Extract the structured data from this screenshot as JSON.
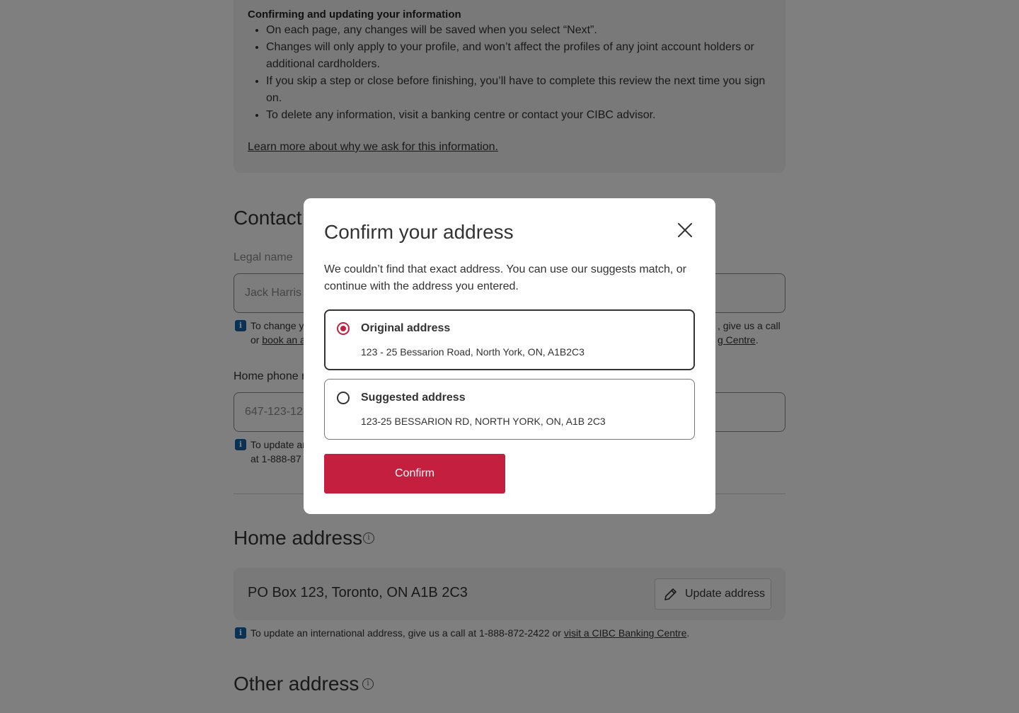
{
  "info_panel": {
    "heading": "Confirming and updating your information",
    "bullets": [
      "On each page, any changes will be saved when you select “Next”.",
      "Changes will only apply to your profile, and won’t affect the profiles of any joint account holders or additional cardholders.",
      "If you skip a step or close before finishing, you’ll have to complete this review the next time you sign on.",
      "To delete any information, visit a banking centre or contact your CIBC advisor."
    ],
    "learn_more": "Learn more about why we ask for this information."
  },
  "contact": {
    "title": "Contact",
    "legal_name_label": "Legal name",
    "legal_name_value": "Jack Harris",
    "legal_helper_left_1": "To change y",
    "legal_helper_left_2": "or ",
    "legal_helper_link_left": "book an a",
    "legal_helper_right_1": ", give us a call",
    "legal_helper_link_right": "g Centre",
    "legal_helper_right_end": ".",
    "home_phone_label": "Home phone n",
    "home_phone_value": "647-123-123",
    "phone_helper_1": "To update ar",
    "phone_helper_2": "at 1-888-87"
  },
  "home_address": {
    "title": "Home address",
    "value": "PO Box 123, Toronto, ON A1B 2C3",
    "update_label": "Update address",
    "helper_text": "To update an international address, give us a call at 1-888-872-2422 or ",
    "helper_link": "visit a CIBC Banking Centre",
    "helper_end": "."
  },
  "other_address": {
    "title": "Other address"
  },
  "modal": {
    "title": "Confirm your address",
    "description": "We couldn’t find that exact address. You can use our suggests match, or continue with the address you entered.",
    "options": [
      {
        "title": "Original address",
        "address": "123 - 25 Bessarion Road, North York, ON, A1B2C3",
        "selected": true
      },
      {
        "title": "Suggested address",
        "address": "123-25 BESSARION RD, NORTH YORK, ON, A1B 2C3",
        "selected": false
      }
    ],
    "confirm_label": "Confirm"
  },
  "colors": {
    "brand_red": "#c41f3e",
    "info_blue": "#1565a8",
    "overlay": "rgba(0,0,0,0.5)"
  },
  "icons": [
    "close-icon",
    "info-icon",
    "pencil-icon",
    "info-circle-icon"
  ]
}
